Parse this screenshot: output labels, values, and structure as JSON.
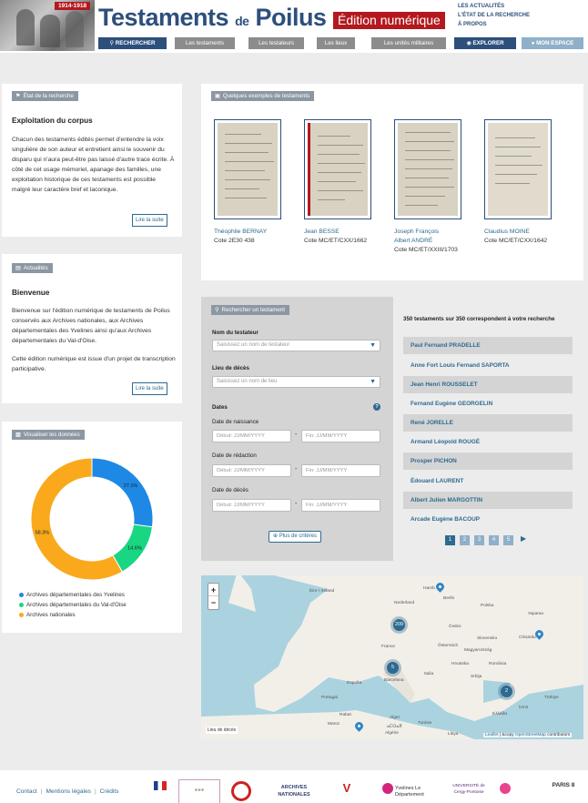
{
  "header": {
    "years": "1914-1918",
    "title_1": "Testaments",
    "title_de": "de",
    "title_2": "Poilus",
    "edition": "Édition numérique",
    "top_links": [
      "LES ACTUALITÉS",
      "L'ÉTAT DE LA RECHERCHE",
      "À PROPOS"
    ],
    "nav": {
      "search": "RECHERCHER",
      "testaments": "Les testaments",
      "testateurs": "Les testateurs",
      "lieux": "Les lieux",
      "unites": "Les unités militaires",
      "explorer": "EXPLORER",
      "mon_espace": "MON ESPACE"
    }
  },
  "etat": {
    "tag": "État de la recherche",
    "title": "Exploitation du corpus",
    "body": "Chacun des testaments édités permet d'entendre la voix singulière de son auteur et entretient ainsi le souvenir du disparu qui n'aura peut-être pas laissé d'autre trace écrite. À côté de cet usage mémoriel, apanage des familles, une exploitation historique de ces testaments est possible malgré leur caractère bref et laconique.",
    "button": "Lire la suite"
  },
  "actualites": {
    "tag": "Actualités",
    "title": "Bienvenue",
    "body_1": "Bienvenue sur l'édition numérique de testaments de Poilus conservés aux Archives nationales, aux Archives départementales des Yvelines ainsi qu'aux Archives départementales du Val-d'Oise.",
    "body_2": "Cette édition numérique est issue d'un projet de transcription participative.",
    "button": "Lire la suite"
  },
  "visualiser": {
    "tag": "Visualiser les données",
    "chart_data": {
      "type": "pie",
      "categories": [
        "Archives départementales des Yvelines",
        "Archives départementales du Val-d'Oise",
        "Archives nationales"
      ],
      "values": [
        27.1,
        14.6,
        58.3
      ],
      "labels": [
        "27.1%",
        "14.6%",
        "58.3%"
      ],
      "colors": [
        "#1e88e5",
        "#18d682",
        "#f9a91b"
      ],
      "legend_position": "bottom-left"
    }
  },
  "exemples": {
    "tag": "Quelques exemples de testaments",
    "items": [
      {
        "name": "Théophile BERNAY",
        "cote": "Cote 2E30 438"
      },
      {
        "name": "Jean BESSE",
        "cote": "Cote MC/ET/CXX/1662"
      },
      {
        "name": "Joseph François Albert ANDRÉ",
        "cote": "Cote MC/ET/XXIII/1703"
      },
      {
        "name": "Claudius MOINE",
        "cote": "Cote MC/ET/CXX/1642"
      }
    ]
  },
  "search": {
    "tag": "Rechercher un testament",
    "nom_label": "Nom du testateur",
    "nom_placeholder": "Saisissez un nom de testateur",
    "lieu_label": "Lieu de décès",
    "lieu_placeholder": "Saisissez un nom de lieu",
    "dates_label": "Dates",
    "help": "?",
    "naissance_label": "Date de naissance",
    "redaction_label": "Date de rédaction",
    "deces_label": "Date de décès",
    "debut_placeholder": "Début: JJ/MM/YYYY",
    "fin_placeholder": "Fin: JJ/MM/YYYY",
    "more": "Plus de critères"
  },
  "results": {
    "count": "350 testaments sur 350 correspondent à votre recherche",
    "items": [
      "Paul Fernand PRADELLE",
      "Anne Fort Louis Fernand SAPORTA",
      "Jean Henri ROUSSELET",
      "Fernand Eugène GEORGELIN",
      "René JORELLE",
      "Armand Léopold ROUGÉ",
      "Prosper PICHON",
      "Édouard LAURENT",
      "Albert Julien MARGOTTIN",
      "Arcade Eugène BACOUP"
    ],
    "pages": [
      "1",
      "2",
      "3",
      "4",
      "5"
    ],
    "next": "▶"
  },
  "map": {
    "zoom_in": "+",
    "zoom_out": "−",
    "labels": [
      {
        "t": "Hamb",
        "k": "hamb"
      },
      {
        "t": "Berlin",
        "k": "berlin"
      },
      {
        "t": "Nederland",
        "k": "ned"
      },
      {
        "t": "Polska",
        "k": "pol"
      },
      {
        "t": "Éire / Ireland",
        "k": "eire"
      },
      {
        "t": "France",
        "k": "france"
      },
      {
        "t": "Česko",
        "k": "cesko"
      },
      {
        "t": "Slovensko",
        "k": "slov"
      },
      {
        "t": "Österreich",
        "k": "ost"
      },
      {
        "t": "Magyarország",
        "k": "mag"
      },
      {
        "t": "România",
        "k": "rom"
      },
      {
        "t": "Chișinău",
        "k": "chis"
      },
      {
        "t": "Україна",
        "k": "ukr"
      },
      {
        "t": "Hrvatska",
        "k": "hrv"
      },
      {
        "t": "Srbija",
        "k": "srb"
      },
      {
        "t": "Italia",
        "k": "ital"
      },
      {
        "t": "Barcelona",
        "k": "barc"
      },
      {
        "t": "España",
        "k": "esp"
      },
      {
        "t": "Portugal",
        "k": "port"
      },
      {
        "t": "Ελλάδα",
        "k": "ell"
      },
      {
        "t": "Türkiye",
        "k": "turk"
      },
      {
        "t": "İzmir",
        "k": "izmir"
      },
      {
        "t": "Rabat",
        "k": "rabat"
      },
      {
        "t": "Alger",
        "k": "alger"
      },
      {
        "t": "Tunisie",
        "k": "tun"
      },
      {
        "t": "Maroc",
        "k": "maroc"
      },
      {
        "t": "ⴰⵎⵔⴰⴳ",
        "k": "amr"
      },
      {
        "t": "Algérie",
        "k": "alg"
      },
      {
        "t": "Libya",
        "k": "lib"
      }
    ],
    "clusters": [
      {
        "count": "209",
        "k": "c209"
      },
      {
        "count": "5",
        "k": "c5"
      },
      {
        "count": "2",
        "k": "c2"
      }
    ],
    "lieu_deces": "Lieu de décès",
    "attribution_leaflet": "Leaflet",
    "attribution_copy": " | &copy ",
    "attribution_osm": "OpenStreetMap",
    "attribution_tail": " contributors"
  },
  "footer": {
    "links": [
      "Contact",
      "Mentions légales",
      "Crédits"
    ],
    "separator": "|",
    "logos": [
      "ARCHIVES NATIONALES",
      "Yvelines Le Département",
      "UNIVERSITÉ de Cergy-Pontoise",
      "PARIS 8"
    ]
  }
}
